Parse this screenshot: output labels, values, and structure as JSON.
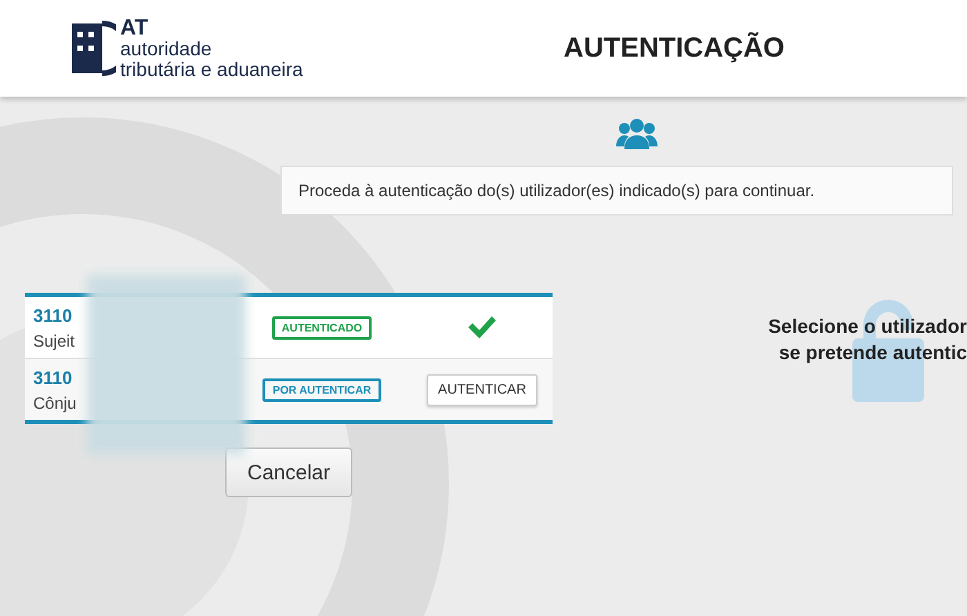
{
  "header": {
    "logo": {
      "abbr": "AT",
      "line_1": "autoridade",
      "line_2": "tributária e aduaneira"
    },
    "title": "AUTENTICAÇÃO"
  },
  "message": "Proceda à autenticação do(s) utilizador(es) indicado(s) para continuar.",
  "users": [
    {
      "number": "3110",
      "role": "Sujeit",
      "status": "AUTENTICADO",
      "kind": "authenticated"
    },
    {
      "number": "3110",
      "role": "Cônju",
      "status": "POR AUTENTICAR",
      "kind": "pending",
      "action": "AUTENTICAR"
    }
  ],
  "cancel_button": "Cancelar",
  "side_hint": {
    "line_1": "Selecione o utilizador",
    "line_2": "se pretende autentic"
  }
}
